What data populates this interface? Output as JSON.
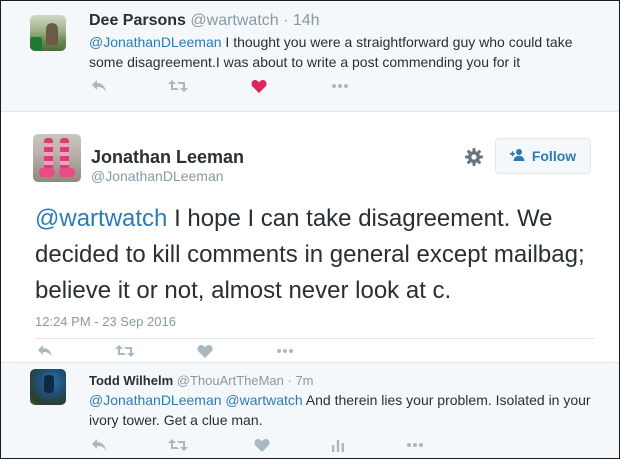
{
  "reply_above": {
    "name": "Dee Parsons",
    "handle": "@wartwatch · 14h",
    "mention": "@JonathanDLeeman",
    "text": " I thought you were a straightforward guy who could take some disagreement.I was about to write a post commending you for it"
  },
  "main_tweet": {
    "name": "Jonathan Leeman",
    "handle": "@JonathanDLeeman",
    "follow_label": "Follow",
    "mention": "@wartwatch",
    "text": " I hope I can take disagreement. We decided to kill comments in general except mailbag; believe it or not, almost never look at c.",
    "timestamp": "12:24 PM - 23 Sep 2016"
  },
  "reply_below": {
    "name": "Todd Wilhelm",
    "handle": "@ThouArtTheMan · 7m",
    "mention1": "@JonathanDLeeman",
    "mention2": "@wartwatch",
    "text": " And therein lies your problem. Isolated in your ivory tower. Get a clue man."
  },
  "colors": {
    "link": "#2b7bb9",
    "muted": "#8899a6",
    "icon": "#aab8c2",
    "liked": "#e0245e",
    "text": "#292f33",
    "reply_bg": "#f5f8fa"
  }
}
